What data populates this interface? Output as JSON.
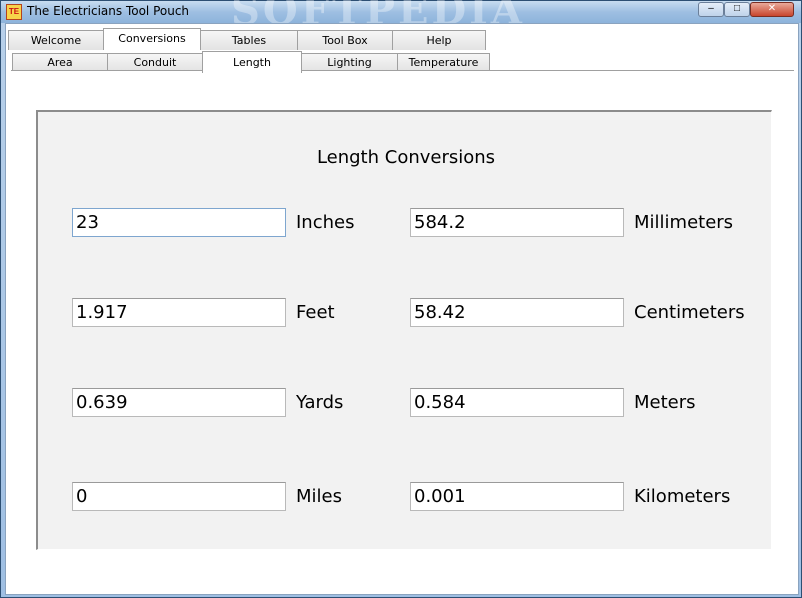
{
  "window": {
    "title": "The Electricians Tool Pouch",
    "icon_text": "TE",
    "watermark": "SOFTPEDIA",
    "controls": {
      "minimize": "–",
      "maximize": "□",
      "close": "✕"
    }
  },
  "tabs_primary": [
    "Welcome",
    "Conversions",
    "Tables",
    "Tool Box",
    "Help"
  ],
  "tabs_secondary": [
    "Area",
    "Conduit",
    "Length",
    "Lighting",
    "Temperature"
  ],
  "panel": {
    "title": "Length Conversions",
    "left": [
      {
        "value": "23",
        "unit": "Inches"
      },
      {
        "value": "1.917",
        "unit": "Feet"
      },
      {
        "value": "0.639",
        "unit": "Yards"
      },
      {
        "value": "0",
        "unit": "Miles"
      }
    ],
    "right": [
      {
        "value": "584.2",
        "unit": "Millimeters"
      },
      {
        "value": "58.42",
        "unit": "Centimeters"
      },
      {
        "value": "0.584",
        "unit": "Meters"
      },
      {
        "value": "0.001",
        "unit": "Kilometers"
      }
    ]
  }
}
